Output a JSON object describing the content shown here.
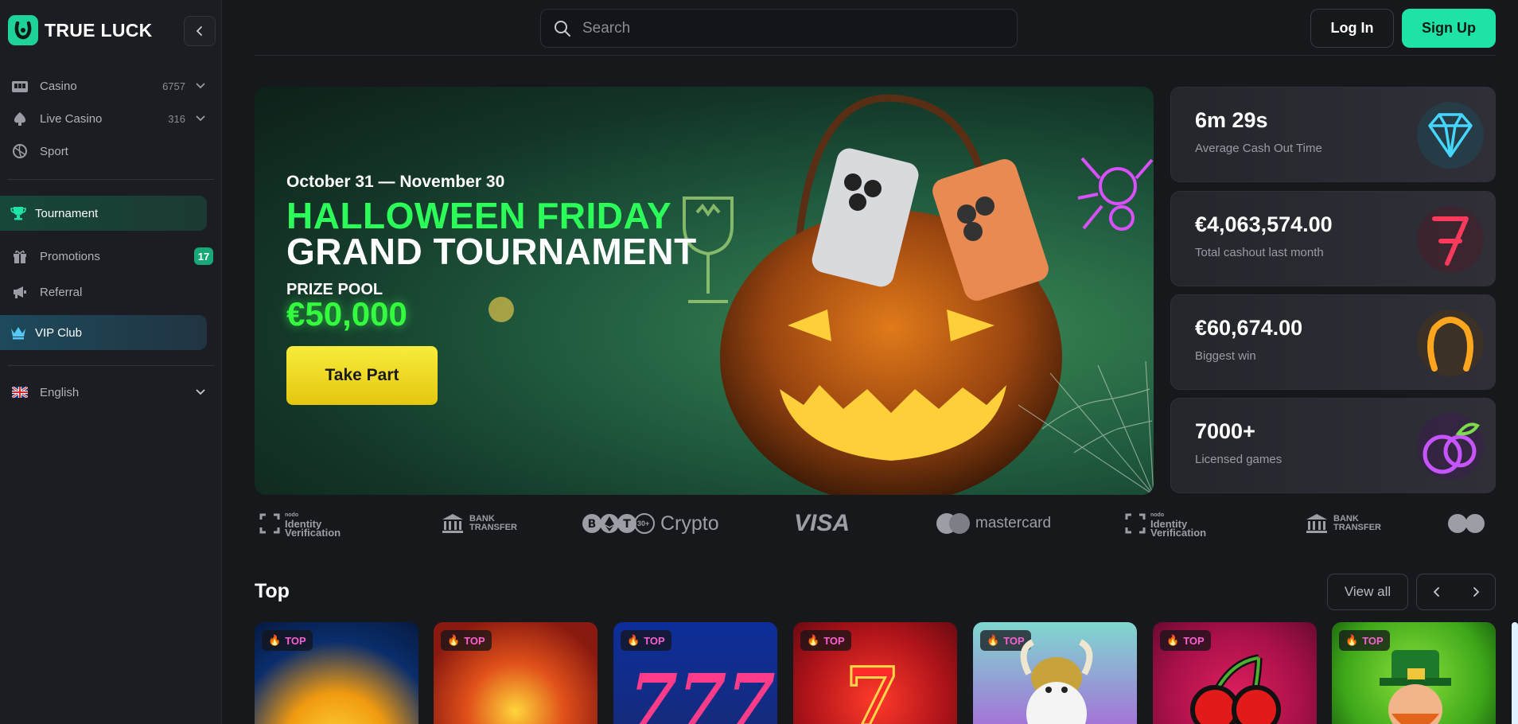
{
  "brand": {
    "name": "TRUE LUCK"
  },
  "sidebar": {
    "items": [
      {
        "label": "Casino",
        "count": "6757"
      },
      {
        "label": "Live Casino",
        "count": "316"
      },
      {
        "label": "Sport"
      }
    ],
    "highlights": [
      {
        "label": "Tournament"
      },
      {
        "label": "Promotions",
        "badge": "17"
      },
      {
        "label": "Referral"
      },
      {
        "label": "VIP Club"
      }
    ],
    "language": "English"
  },
  "header": {
    "search_placeholder": "Search",
    "login_label": "Log In",
    "signup_label": "Sign Up"
  },
  "banner": {
    "dates": "October 31 — November 30",
    "title_line1": "HALLOWEEN FRIDAY",
    "title_line2": "GRAND TOURNAMENT",
    "prize_label": "PRIZE POOL",
    "prize_value": "€50,000",
    "cta_label": "Take Part"
  },
  "stats": [
    {
      "value": "6m 29s",
      "label": "Average Cash Out Time",
      "icon": "diamond-icon"
    },
    {
      "value": "€4,063,574.00",
      "label": "Total cashout last month",
      "icon": "seven-icon"
    },
    {
      "value": "€60,674.00",
      "label": "Biggest win",
      "icon": "horseshoe-icon"
    },
    {
      "value": "7000+",
      "label": "Licensed games",
      "icon": "plum-icon"
    }
  ],
  "payments": {
    "identity_small": "nodo",
    "identity_line1": "Identity",
    "identity_line2": "Verification",
    "bank_line1": "BANK",
    "bank_line2": "TRANSFER",
    "crypto_count": "30+",
    "crypto_label": "Crypto",
    "visa_label": "VISA",
    "mastercard_label": "mastercard"
  },
  "top_section": {
    "title": "Top",
    "view_all_label": "View all",
    "badge_label": "TOP"
  },
  "colors": {
    "accent": "#1ee3a6",
    "banner_green": "#2cff5a",
    "cta_yellow": "#f0dc22",
    "badge_pink": "#ff5fd2"
  }
}
